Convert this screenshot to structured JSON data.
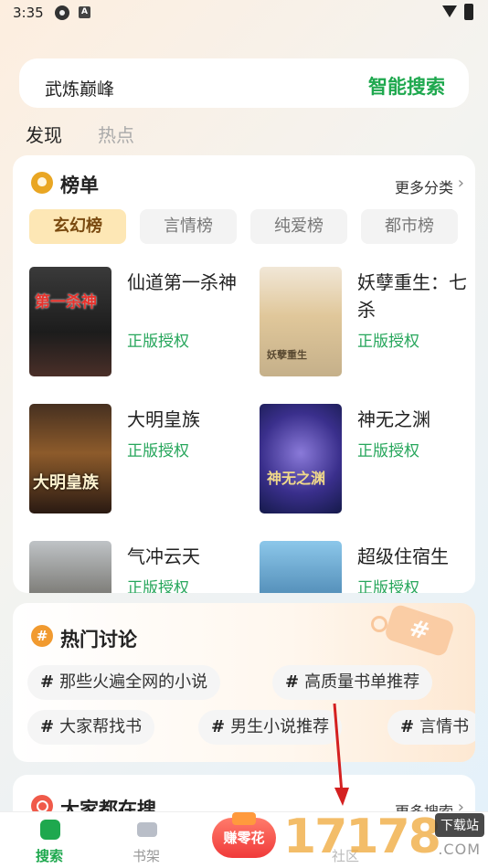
{
  "status_bar": {
    "time": "3:35",
    "badge": "A"
  },
  "search": {
    "query": "武炼巅峰",
    "button": "智能搜索"
  },
  "top_tabs": [
    {
      "label": "发现",
      "active": true
    },
    {
      "label": "热点",
      "active": false
    }
  ],
  "ranking": {
    "title": "榜单",
    "more": "更多分类",
    "tabs": [
      "玄幻榜",
      "言情榜",
      "纯爱榜",
      "都市榜"
    ],
    "active_tab": "玄幻榜",
    "books": [
      {
        "title": "仙道第一杀神",
        "badge": "正版授权",
        "cover_text": "第一杀神"
      },
      {
        "title": "妖孽重生：七杀",
        "badge": "正版授权",
        "cover_text": "妖孽重生"
      },
      {
        "title": "大明皇族",
        "badge": "正版授权",
        "cover_text": "大明皇族"
      },
      {
        "title": "神无之渊",
        "badge": "正版授权",
        "cover_text": "神无之渊"
      },
      {
        "title": "气冲云天",
        "badge": "正版授权",
        "cover_text": ""
      },
      {
        "title": "超级住宿生",
        "badge": "正版授权",
        "cover_text": ""
      }
    ]
  },
  "discussion": {
    "title": "热门讨论",
    "topics": [
      "那些火遍全网的小说",
      "高质量书单推荐",
      "大家帮找书",
      "男生小说推荐",
      "言情书"
    ]
  },
  "trending": {
    "title": "大家都在搜",
    "more": "更多搜索"
  },
  "bottom_nav": {
    "items": [
      {
        "label": "搜索",
        "active": true
      },
      {
        "label": "书架",
        "active": false
      },
      {
        "label": "赚零花",
        "active": false
      },
      {
        "label": "社区",
        "active": false
      }
    ]
  },
  "watermark": {
    "number": "17178",
    "label": "下载站",
    "sub": ".COM"
  },
  "colors": {
    "accent": "#1ea84e",
    "badge_green": "#26a65b",
    "gold_tab": "#fde7b5",
    "earn_red": "#f03a3a"
  }
}
